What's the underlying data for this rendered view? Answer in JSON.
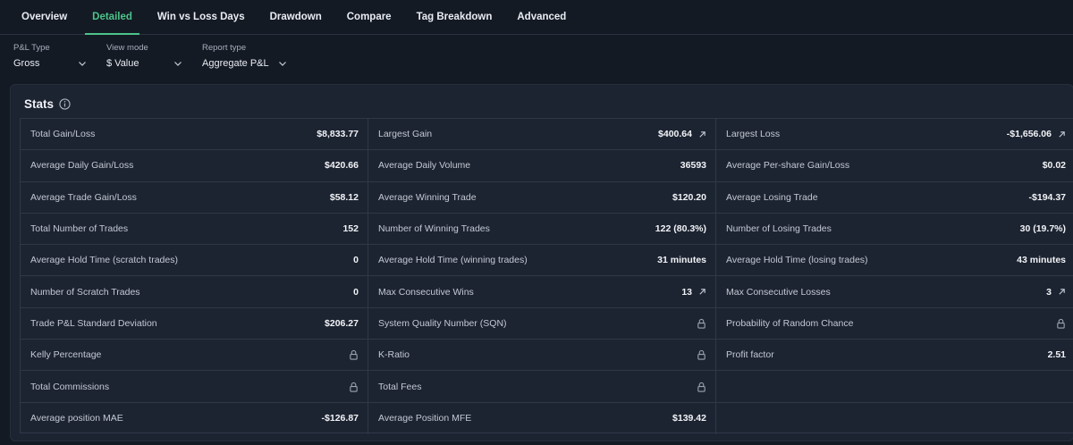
{
  "tabs": [
    {
      "label": "Overview",
      "active": false
    },
    {
      "label": "Detailed",
      "active": true
    },
    {
      "label": "Win vs Loss Days",
      "active": false
    },
    {
      "label": "Drawdown",
      "active": false
    },
    {
      "label": "Compare",
      "active": false
    },
    {
      "label": "Tag Breakdown",
      "active": false
    },
    {
      "label": "Advanced",
      "active": false
    }
  ],
  "filters": [
    {
      "label": "P&L Type",
      "value": "Gross"
    },
    {
      "label": "View mode",
      "value": "$ Value"
    },
    {
      "label": "Report type",
      "value": "Aggregate P&L"
    }
  ],
  "stats": {
    "title": "Stats",
    "cells": [
      {
        "label": "Total Gain/Loss",
        "value": "$8,833.77"
      },
      {
        "label": "Largest Gain",
        "value": "$400.64",
        "icon": "external-link-icon"
      },
      {
        "label": "Largest Loss",
        "value": "-$1,656.06",
        "icon": "external-link-icon"
      },
      {
        "label": "Average Daily Gain/Loss",
        "value": "$420.66"
      },
      {
        "label": "Average Daily Volume",
        "value": "36593"
      },
      {
        "label": "Average Per-share Gain/Loss",
        "value": "$0.02"
      },
      {
        "label": "Average Trade Gain/Loss",
        "value": "$58.12"
      },
      {
        "label": "Average Winning Trade",
        "value": "$120.20"
      },
      {
        "label": "Average Losing Trade",
        "value": "-$194.37"
      },
      {
        "label": "Total Number of Trades",
        "value": "152"
      },
      {
        "label": "Number of Winning Trades",
        "value": "122 (80.3%)"
      },
      {
        "label": "Number of Losing Trades",
        "value": "30 (19.7%)"
      },
      {
        "label": "Average Hold Time (scratch trades)",
        "value": "0"
      },
      {
        "label": "Average Hold Time (winning trades)",
        "value": "31 minutes"
      },
      {
        "label": "Average Hold Time (losing trades)",
        "value": "43 minutes"
      },
      {
        "label": "Number of Scratch Trades",
        "value": "0"
      },
      {
        "label": "Max Consecutive Wins",
        "value": "13",
        "icon": "external-link-icon"
      },
      {
        "label": "Max Consecutive Losses",
        "value": "3",
        "icon": "external-link-icon"
      },
      {
        "label": "Trade P&L Standard Deviation",
        "value": "$206.27"
      },
      {
        "label": "System Quality Number (SQN)",
        "value": "",
        "icon": "lock-icon"
      },
      {
        "label": "Probability of Random Chance",
        "value": "",
        "icon": "lock-icon"
      },
      {
        "label": "Kelly Percentage",
        "value": "",
        "icon": "lock-icon"
      },
      {
        "label": "K-Ratio",
        "value": "",
        "icon": "lock-icon"
      },
      {
        "label": "Profit factor",
        "value": "2.51"
      },
      {
        "label": "Total Commissions",
        "value": "",
        "icon": "lock-icon"
      },
      {
        "label": "Total Fees",
        "value": "",
        "icon": "lock-icon"
      },
      {
        "label": "",
        "value": ""
      },
      {
        "label": "Average position MAE",
        "value": "-$126.87"
      },
      {
        "label": "Average Position MFE",
        "value": "$139.42"
      },
      {
        "label": "",
        "value": ""
      }
    ]
  },
  "colors": {
    "accent": "#4cc38a",
    "background": "#141a24",
    "panel": "#1d2431"
  }
}
